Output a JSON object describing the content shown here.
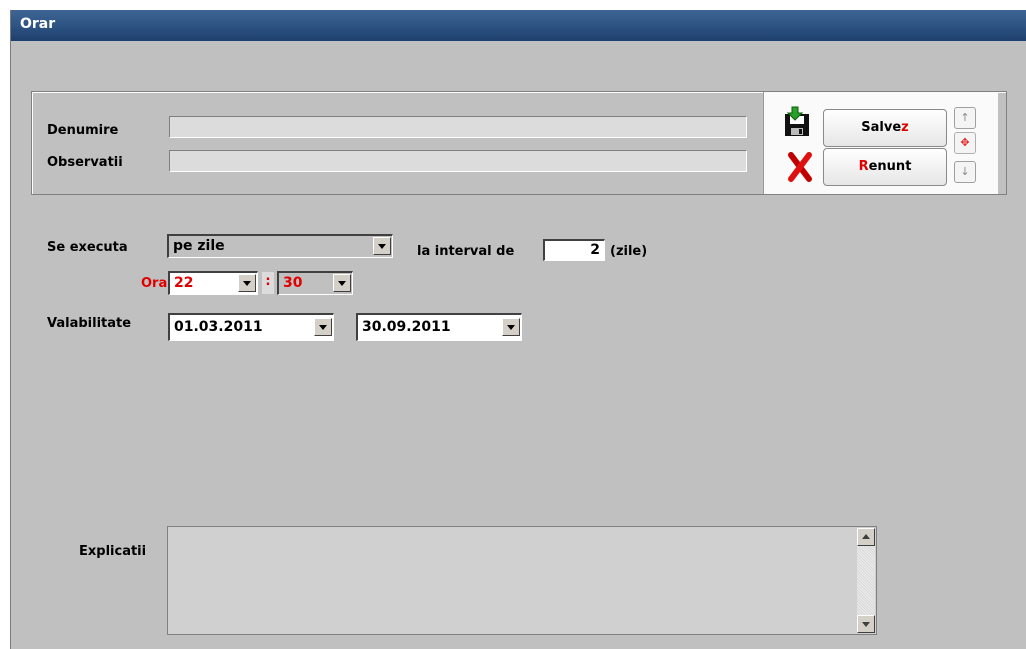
{
  "window": {
    "title": "Orar"
  },
  "form": {
    "denumire_label": "Denumire",
    "denumire_value": "",
    "observatii_label": "Observatii",
    "observatii_value": ""
  },
  "buttons": {
    "save_prefix": "Salve",
    "save_hotkey": "z",
    "cancel_hotkey": "R",
    "cancel_suffix": "enunt"
  },
  "schedule": {
    "se_executa_label": "Se executa",
    "se_executa_value": "pe zile",
    "interval_label": "la interval de",
    "interval_value": "2",
    "interval_unit": "(zile)",
    "ora_label": "Ora",
    "hour": "22",
    "separator": ":",
    "minute": "30",
    "valabilitate_label": "Valabilitate",
    "date_from": "01.03.2011",
    "date_to": "30.09.2011"
  },
  "explicatii": {
    "label": "Explicatii",
    "value": ""
  },
  "colors": {
    "title_bar": "#2c5282",
    "accent_red": "#e00000",
    "background": "#c0c0c0"
  }
}
